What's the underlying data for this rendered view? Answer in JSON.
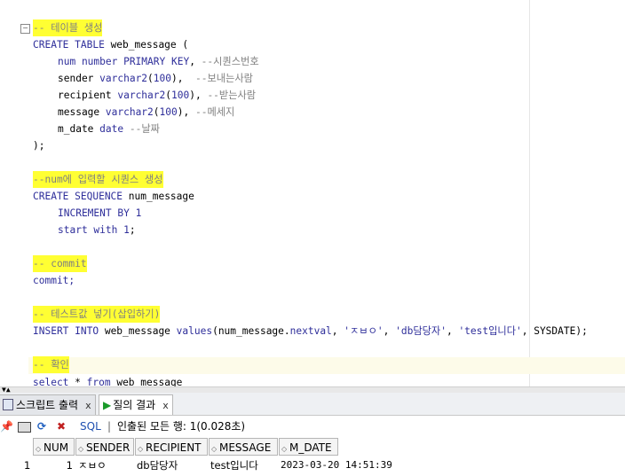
{
  "editor": {
    "c1": "-- 테이블 생성",
    "l2_kw": "CREATE TABLE",
    "l2_rest": " web_message (",
    "l3_a": "num number PRIMARY KEY",
    "l3_b": ", ",
    "l3_c": "--시퀀스번호",
    "l4_a": "sender ",
    "l4_b": "varchar2",
    "l4_c": "(",
    "l4_d": "100",
    "l4_e": "),  ",
    "l4_f": "--보내는사람",
    "l5_a": "recipient ",
    "l5_b": "varchar2",
    "l5_c": "(",
    "l5_d": "100",
    "l5_e": "), ",
    "l5_f": "--받는사람",
    "l6_a": "message ",
    "l6_b": "varchar2",
    "l6_c": "(",
    "l6_d": "100",
    "l6_e": "), ",
    "l6_f": "--메세지",
    "l7_a": "m_date ",
    "l7_b": "date",
    "l7_c": " --날짜",
    "l8": ");",
    "c2": "--num에 입력할 시퀀스 생성",
    "l11_kw": "CREATE SEQUENCE",
    "l11_rest": " num_message",
    "l12_kw": "INCREMENT BY",
    "l12_n": " 1",
    "l13_kw": "start with",
    "l13_n": " 1",
    "l13_e": ";",
    "c3": "-- commit",
    "l16": "commit;",
    "c4": "-- 테스트값 넣기(삽입하기)",
    "l19_a": "INSERT INTO",
    "l19_b": " web_message ",
    "l19_c": "values",
    "l19_d": "(num_message.",
    "l19_e": "nextval",
    "l19_f": ", ",
    "l19_g": "'ㅈㅂㅇ'",
    "l19_h": ", ",
    "l19_i": "'db담당자'",
    "l19_j": ", ",
    "l19_k": "'test입니다'",
    "l19_l": ", SYSDATE);",
    "c5": "-- 확인",
    "l22_a": "select",
    "l22_b": " * ",
    "l22_c": "from",
    "l22_d": " web_message"
  },
  "tabs": [
    {
      "label": "스크립트 출력",
      "close": "x"
    },
    {
      "label": "질의 결과",
      "close": "x"
    }
  ],
  "toolbar": {
    "sql": "SQL",
    "sep": "|",
    "status": "인출된 모든 행: 1(0.028초)"
  },
  "grid": {
    "columns": [
      "NUM",
      "SENDER",
      "RECIPIENT",
      "MESSAGE",
      "M_DATE"
    ],
    "row_number": "1",
    "rows": [
      [
        "1",
        "ㅈㅂㅇ",
        "db담당자",
        "test입니다",
        "2023-03-20 14:51:39"
      ]
    ]
  }
}
